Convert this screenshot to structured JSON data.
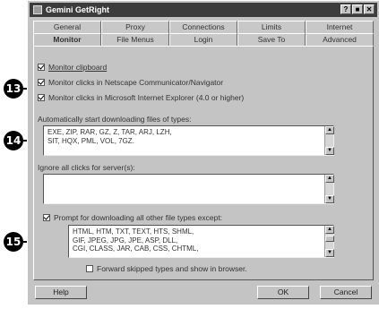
{
  "window": {
    "title": "Gemini GetRight",
    "controls": [
      "?",
      "■",
      "✕"
    ]
  },
  "tabs_top": [
    "General",
    "Proxy",
    "Connections",
    "Limits",
    "Internet"
  ],
  "tabs_bottom": [
    "Monitor",
    "File Menus",
    "Login",
    "Save To",
    "Advanced"
  ],
  "active_tab": "Monitor",
  "monitor": {
    "monitor_clipboard": {
      "label": "Monitor clipboard",
      "checked": true
    },
    "monitor_netscape": {
      "label": "Monitor clicks in Netscape Communicator/Navigator",
      "checked": true
    },
    "monitor_ie": {
      "label": "Monitor clicks in Microsoft Internet Explorer (4.0 or higher)",
      "checked": true
    },
    "auto_label": "Automatically start downloading files of types:",
    "auto_types": "EXE, ZIP, RAR, GZ, Z, TAR, ARJ, LZH,\nSIT, HQX, PML, VOL, 7GZ.",
    "ignore_label": "Ignore all clicks for server(s):",
    "ignore_servers": "",
    "prompt": {
      "label": "Prompt for downloading all other file types except:",
      "checked": true
    },
    "except_types": "HTML, HTM, TXT, TEXT, HTS, SHML,\nGIF, JPEG, JPG, JPE, ASP, DLL,\nCGI, CLASS, JAR, CAB, CSS, CHTML,",
    "forward": {
      "label": "Forward skipped types and show in browser.",
      "checked": false
    }
  },
  "buttons": {
    "help": "Help",
    "ok": "OK",
    "cancel": "Cancel"
  },
  "callouts": [
    "13",
    "14",
    "15"
  ]
}
